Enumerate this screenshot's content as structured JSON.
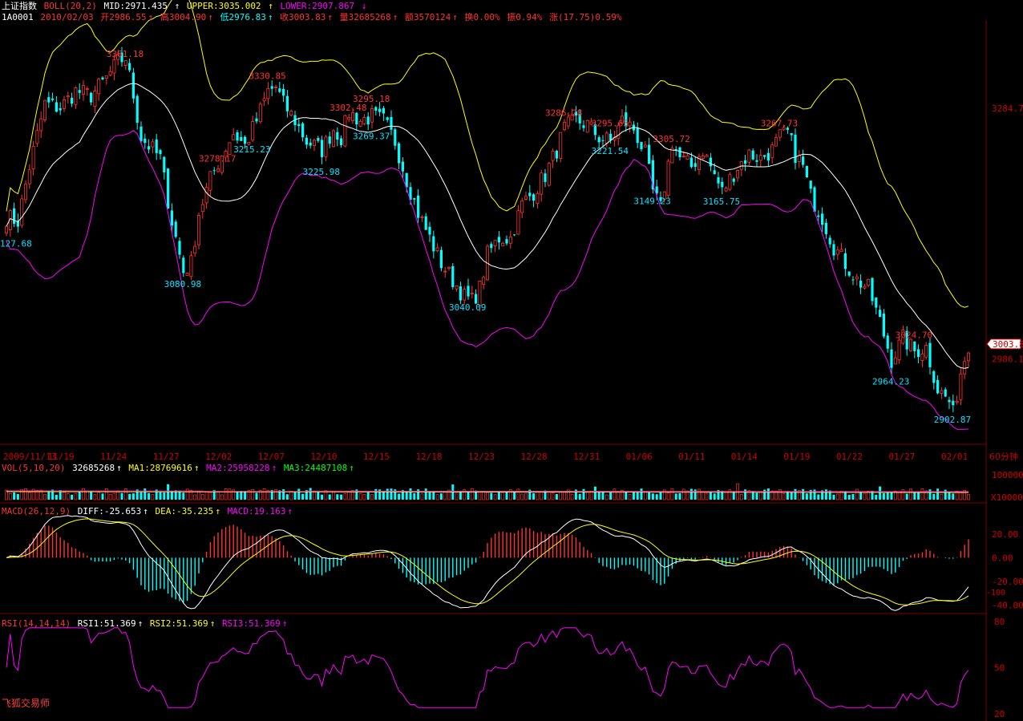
{
  "header": {
    "name": "上证指数",
    "code": "1A0001",
    "date": "2010/02/03",
    "indicator": "BOLL(20,2)",
    "mid": "MID:2971.435",
    "upper": "UPPER:3035.002",
    "lower": "LOWER:2907.867",
    "open": "开2986.55",
    "high": "高3004.90",
    "low": "低2976.83",
    "close": "收3003.83",
    "volume": "量32685268",
    "amount": "额3570124",
    "turnover": "换0.00%",
    "amplitude": "振0.94%",
    "change": "涨(17.75)0.59%"
  },
  "vol_header": {
    "indicator": "VOL(5,10,20)",
    "value": "32685268",
    "ma1": "MA1:28769616",
    "ma2": "MA2:25958228",
    "ma3": "MA3:24487108"
  },
  "macd_header": {
    "indicator": "MACD(26,12,9)",
    "diff": "DIFF:-25.653",
    "dea": "DEA:-35.235",
    "macd": "MACD:19.163"
  },
  "rsi_header": {
    "indicator": "RSI(14,14,14)",
    "rsi1": "RSI1:51.369",
    "rsi2": "RSI2:51.369",
    "rsi3": "RSI3:51.369"
  },
  "watermark": "飞狐交易师",
  "colors": {
    "up": "#ff3232",
    "down": "#00ffff",
    "mid": "#ffffff",
    "upper": "#ffff00",
    "lower": "#ff00ff",
    "label_high": "#ff3232",
    "label_low": "#00e5ff",
    "axis": "#cc0000"
  },
  "chart_data": [
    {
      "type": "candlestick",
      "title": "上证指数 BOLL(20,2)",
      "x_ticks": [
        "2009/11/13",
        "11/19",
        "11/24",
        "11/27",
        "12/02",
        "12/07",
        "12/10",
        "12/15",
        "12/18",
        "12/23",
        "12/28",
        "12/31",
        "01/06",
        "01/11",
        "01/14",
        "01/19",
        "01/22",
        "01/27",
        "02/01"
      ],
      "period_label": "60分钟",
      "y_axis_labels": [
        "3284.7",
        "2986.1"
      ],
      "last_price_label": "3003.8",
      "ylim": [
        2890,
        3385
      ],
      "annotations_high": [
        {
          "text": "3361.18",
          "i": 31
        },
        {
          "text": "3278.17",
          "i": 55
        },
        {
          "text": "3330.85",
          "i": 68
        },
        {
          "text": "3302.48",
          "i": 89
        },
        {
          "text": "3295.18",
          "i": 95
        },
        {
          "text": "3286.28",
          "i": 145
        },
        {
          "text": "3295.65",
          "i": 157
        },
        {
          "text": "3305.72",
          "i": 173
        },
        {
          "text": "3267.73",
          "i": 201
        },
        {
          "text": "3024.70",
          "i": 236
        }
      ],
      "annotations_low": [
        {
          "text": "127.68",
          "i": 0
        },
        {
          "text": "3080.98",
          "i": 46
        },
        {
          "text": "3215.23",
          "i": 64
        },
        {
          "text": "3225.98",
          "i": 82
        },
        {
          "text": "3269.37",
          "i": 95
        },
        {
          "text": "3040.09",
          "i": 120
        },
        {
          "text": "3221.54",
          "i": 157
        },
        {
          "text": "3149.23",
          "i": 168
        },
        {
          "text": "3165.75",
          "i": 186
        },
        {
          "text": "2964.23",
          "i": 230
        },
        {
          "text": "2902.87",
          "i": 246
        }
      ],
      "close_anchors": [
        [
          0,
          3155
        ],
        [
          3,
          3150
        ],
        [
          6,
          3215
        ],
        [
          10,
          3290
        ],
        [
          14,
          3285
        ],
        [
          18,
          3305
        ],
        [
          22,
          3300
        ],
        [
          26,
          3320
        ],
        [
          29,
          3340
        ],
        [
          31,
          3345
        ],
        [
          33,
          3300
        ],
        [
          35,
          3250
        ],
        [
          37,
          3240
        ],
        [
          40,
          3225
        ],
        [
          43,
          3150
        ],
        [
          46,
          3090
        ],
        [
          48,
          3100
        ],
        [
          50,
          3160
        ],
        [
          53,
          3200
        ],
        [
          56,
          3230
        ],
        [
          59,
          3255
        ],
        [
          62,
          3240
        ],
        [
          65,
          3270
        ],
        [
          68,
          3305
        ],
        [
          70,
          3310
        ],
        [
          72,
          3290
        ],
        [
          75,
          3270
        ],
        [
          78,
          3245
        ],
        [
          82,
          3235
        ],
        [
          85,
          3260
        ],
        [
          87,
          3250
        ],
        [
          89,
          3280
        ],
        [
          92,
          3270
        ],
        [
          95,
          3275
        ],
        [
          98,
          3270
        ],
        [
          101,
          3245
        ],
        [
          104,
          3200
        ],
        [
          107,
          3160
        ],
        [
          110,
          3130
        ],
        [
          113,
          3100
        ],
        [
          116,
          3080
        ],
        [
          119,
          3060
        ],
        [
          121,
          3055
        ],
        [
          123,
          3070
        ],
        [
          125,
          3110
        ],
        [
          128,
          3130
        ],
        [
          131,
          3130
        ],
        [
          134,
          3170
        ],
        [
          137,
          3185
        ],
        [
          140,
          3205
        ],
        [
          143,
          3235
        ],
        [
          145,
          3260
        ],
        [
          148,
          3270
        ],
        [
          151,
          3265
        ],
        [
          154,
          3250
        ],
        [
          157,
          3245
        ],
        [
          160,
          3270
        ],
        [
          163,
          3260
        ],
        [
          166,
          3230
        ],
        [
          168,
          3185
        ],
        [
          170,
          3165
        ],
        [
          173,
          3245
        ],
        [
          175,
          3225
        ],
        [
          178,
          3215
        ],
        [
          181,
          3235
        ],
        [
          184,
          3205
        ],
        [
          186,
          3185
        ],
        [
          188,
          3200
        ],
        [
          190,
          3215
        ],
        [
          193,
          3230
        ],
        [
          196,
          3225
        ],
        [
          199,
          3235
        ],
        [
          201,
          3250
        ],
        [
          203,
          3255
        ],
        [
          205,
          3230
        ],
        [
          207,
          3215
        ],
        [
          209,
          3180
        ],
        [
          212,
          3155
        ],
        [
          215,
          3120
        ],
        [
          218,
          3100
        ],
        [
          221,
          3080
        ],
        [
          224,
          3070
        ],
        [
          227,
          3030
        ],
        [
          230,
          2985
        ],
        [
          233,
          3010
        ],
        [
          236,
          2995
        ],
        [
          239,
          3000
        ],
        [
          242,
          2950
        ],
        [
          245,
          2935
        ],
        [
          246,
          2920
        ],
        [
          248,
          2970
        ],
        [
          250,
          3004
        ]
      ],
      "n_bars": 251,
      "series": [
        {
          "name": "MID",
          "value": "2971.435"
        },
        {
          "name": "UPPER",
          "value": "3035.002"
        },
        {
          "name": "LOWER",
          "value": "2907.867"
        }
      ]
    },
    {
      "type": "bar",
      "title": "VOL(5,10,20)",
      "y_axis_labels": [
        "100000",
        "X10000"
      ]
    },
    {
      "type": "line",
      "title": "MACD(26,12,9)",
      "y_axis_labels": [
        "20.00",
        "0.00",
        "-20.00",
        "-40.00",
        "-100"
      ],
      "ylim": [
        -45,
        32
      ]
    },
    {
      "type": "line",
      "title": "RSI(14,14,14)",
      "y_axis_labels": [
        "80",
        "50",
        "20"
      ],
      "ylim": [
        20,
        80
      ]
    }
  ]
}
